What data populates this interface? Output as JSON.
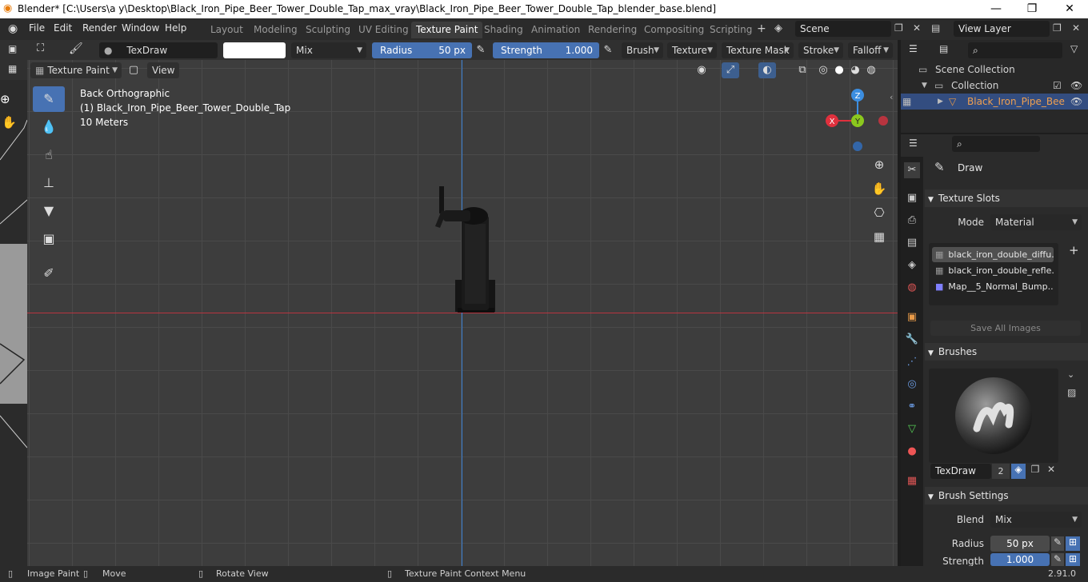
{
  "window": {
    "title": "Blender* [C:\\Users\\a y\\Desktop\\Black_Iron_Pipe_Beer_Tower_Double_Tap_max_vray\\Black_Iron_Pipe_Beer_Tower_Double_Tap_blender_base.blend]",
    "minimize": "—",
    "maximize": "❐",
    "close": "✕"
  },
  "menu": [
    "File",
    "Edit",
    "Render",
    "Window",
    "Help"
  ],
  "workspaces": [
    "Layout",
    "Modeling",
    "Sculpting",
    "UV Editing",
    "Texture Paint",
    "Shading",
    "Animation",
    "Rendering",
    "Compositing",
    "Scripting"
  ],
  "active_workspace": "Texture Paint",
  "scene": "Scene",
  "view_layer": "View Layer",
  "toolheader": {
    "brush_name": "TexDraw",
    "blend": "Mix",
    "radius_label": "Radius",
    "radius_value": "50 px",
    "strength_label": "Strength",
    "strength_value": "1.000",
    "brush_menu": "Brush",
    "texture_menu": "Texture",
    "texture_mask_menu": "Texture Mask",
    "stroke_menu": "Stroke",
    "falloff_menu": "Falloff",
    "mode": "Texture Paint",
    "view": "View"
  },
  "viewport": {
    "view_name": "Back Orthographic",
    "object_info": "(1) Black_Iron_Pipe_Beer_Tower_Double_Tap",
    "scale": "10 Meters",
    "gizmo": {
      "z": "Z",
      "y": "Y",
      "x": "X"
    },
    "colors": {
      "x_axis": "#e0303d",
      "y_axis": "#8bc81e",
      "z_axis": "#3c8ee0"
    }
  },
  "outliner": {
    "scene_collection": "Scene Collection",
    "collection": "Collection",
    "object": "Black_Iron_Pipe_Bee"
  },
  "properties": {
    "active_tool": "Draw",
    "texture_slots_header": "Texture Slots",
    "mode_label": "Mode",
    "mode_value": "Material",
    "slots": [
      "black_iron_double_diffu...",
      "black_iron_double_refle...",
      "Map__5_Normal_Bump...."
    ],
    "save_all_images": "Save All Images",
    "brushes_header": "Brushes",
    "brush_name": "TexDraw",
    "brush_users": "2",
    "brush_settings_header": "Brush Settings",
    "blend_label": "Blend",
    "blend_value": "Mix",
    "radius_label": "Radius",
    "radius_value": "50 px",
    "strength_label": "Strength",
    "strength_value": "1.000"
  },
  "statusbar": {
    "image_paint": "Image Paint",
    "move": "Move",
    "rotate_view": "Rotate View",
    "context_menu": "Texture Paint Context Menu",
    "version": "2.91.0"
  }
}
